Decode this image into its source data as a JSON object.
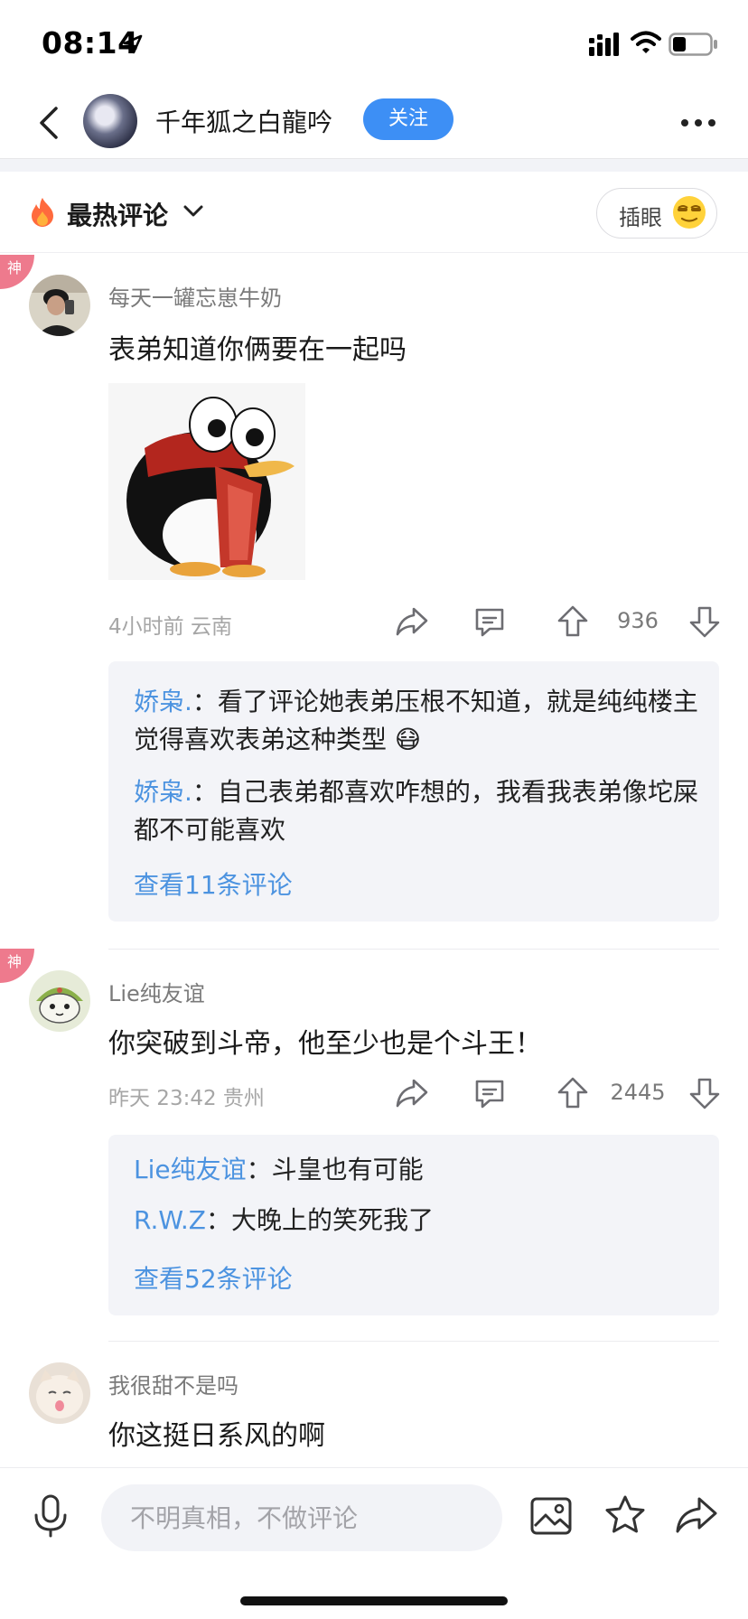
{
  "status_bar": {
    "time": "08:14"
  },
  "header": {
    "title": "千年狐之白龍吟",
    "follow_label": "关注"
  },
  "sort_bar": {
    "label": "最热评论",
    "chaiyan_label": "插眼"
  },
  "comments": [
    {
      "badge": "神",
      "user": "每天一罐忘崽牛奶",
      "text": "表弟知道你俩要在一起吗",
      "time": "4小时前",
      "location": "云南",
      "likes": "936",
      "replies": [
        {
          "name": "娇枭.",
          "sep": "：",
          "text": "看了评论她表弟压根不知道，就是纯纯楼主觉得喜欢表弟这种类型 😷"
        },
        {
          "name": "娇枭.",
          "sep": "：",
          "text": "自己表弟都喜欢咋想的，我看我表弟像坨屎都不可能喜欢"
        }
      ],
      "view_more": "查看11条评论"
    },
    {
      "badge": "神",
      "user": "Lie纯友谊",
      "text": "你突破到斗帝，他至少也是个斗王！",
      "time": "昨天 23:42",
      "location": "贵州",
      "likes": "2445",
      "replies": [
        {
          "name": "Lie纯友谊",
          "sep": "：",
          "text": "斗皇也有可能"
        },
        {
          "name": "R.W.Z",
          "sep": "：",
          "text": "大晚上的笑死我了"
        }
      ],
      "view_more": "查看52条评论"
    },
    {
      "user": "我很甜不是吗",
      "text": "你这挺日系风的啊"
    }
  ],
  "bottom_bar": {
    "input_placeholder": "不明真相，不做评论"
  },
  "colors": {
    "accent": "#3d8ff5",
    "reply_name": "#4c93e0",
    "god_badge": "#ee7a8d",
    "reply_bg": "#f3f4f8"
  }
}
